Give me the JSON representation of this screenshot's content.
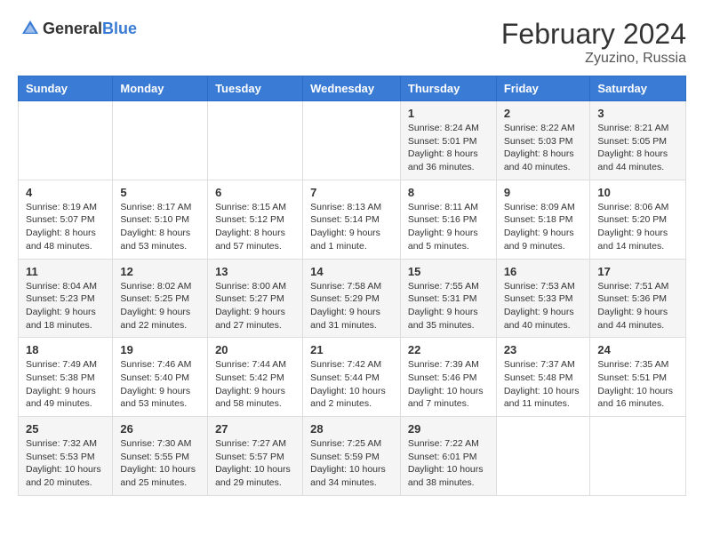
{
  "header": {
    "logo_general": "General",
    "logo_blue": "Blue",
    "month_year": "February 2024",
    "location": "Zyuzino, Russia"
  },
  "days_of_week": [
    "Sunday",
    "Monday",
    "Tuesday",
    "Wednesday",
    "Thursday",
    "Friday",
    "Saturday"
  ],
  "weeks": [
    [
      {
        "day": "",
        "info": ""
      },
      {
        "day": "",
        "info": ""
      },
      {
        "day": "",
        "info": ""
      },
      {
        "day": "",
        "info": ""
      },
      {
        "day": "1",
        "info": "Sunrise: 8:24 AM\nSunset: 5:01 PM\nDaylight: 8 hours and 36 minutes."
      },
      {
        "day": "2",
        "info": "Sunrise: 8:22 AM\nSunset: 5:03 PM\nDaylight: 8 hours and 40 minutes."
      },
      {
        "day": "3",
        "info": "Sunrise: 8:21 AM\nSunset: 5:05 PM\nDaylight: 8 hours and 44 minutes."
      }
    ],
    [
      {
        "day": "4",
        "info": "Sunrise: 8:19 AM\nSunset: 5:07 PM\nDaylight: 8 hours and 48 minutes."
      },
      {
        "day": "5",
        "info": "Sunrise: 8:17 AM\nSunset: 5:10 PM\nDaylight: 8 hours and 53 minutes."
      },
      {
        "day": "6",
        "info": "Sunrise: 8:15 AM\nSunset: 5:12 PM\nDaylight: 8 hours and 57 minutes."
      },
      {
        "day": "7",
        "info": "Sunrise: 8:13 AM\nSunset: 5:14 PM\nDaylight: 9 hours and 1 minute."
      },
      {
        "day": "8",
        "info": "Sunrise: 8:11 AM\nSunset: 5:16 PM\nDaylight: 9 hours and 5 minutes."
      },
      {
        "day": "9",
        "info": "Sunrise: 8:09 AM\nSunset: 5:18 PM\nDaylight: 9 hours and 9 minutes."
      },
      {
        "day": "10",
        "info": "Sunrise: 8:06 AM\nSunset: 5:20 PM\nDaylight: 9 hours and 14 minutes."
      }
    ],
    [
      {
        "day": "11",
        "info": "Sunrise: 8:04 AM\nSunset: 5:23 PM\nDaylight: 9 hours and 18 minutes."
      },
      {
        "day": "12",
        "info": "Sunrise: 8:02 AM\nSunset: 5:25 PM\nDaylight: 9 hours and 22 minutes."
      },
      {
        "day": "13",
        "info": "Sunrise: 8:00 AM\nSunset: 5:27 PM\nDaylight: 9 hours and 27 minutes."
      },
      {
        "day": "14",
        "info": "Sunrise: 7:58 AM\nSunset: 5:29 PM\nDaylight: 9 hours and 31 minutes."
      },
      {
        "day": "15",
        "info": "Sunrise: 7:55 AM\nSunset: 5:31 PM\nDaylight: 9 hours and 35 minutes."
      },
      {
        "day": "16",
        "info": "Sunrise: 7:53 AM\nSunset: 5:33 PM\nDaylight: 9 hours and 40 minutes."
      },
      {
        "day": "17",
        "info": "Sunrise: 7:51 AM\nSunset: 5:36 PM\nDaylight: 9 hours and 44 minutes."
      }
    ],
    [
      {
        "day": "18",
        "info": "Sunrise: 7:49 AM\nSunset: 5:38 PM\nDaylight: 9 hours and 49 minutes."
      },
      {
        "day": "19",
        "info": "Sunrise: 7:46 AM\nSunset: 5:40 PM\nDaylight: 9 hours and 53 minutes."
      },
      {
        "day": "20",
        "info": "Sunrise: 7:44 AM\nSunset: 5:42 PM\nDaylight: 9 hours and 58 minutes."
      },
      {
        "day": "21",
        "info": "Sunrise: 7:42 AM\nSunset: 5:44 PM\nDaylight: 10 hours and 2 minutes."
      },
      {
        "day": "22",
        "info": "Sunrise: 7:39 AM\nSunset: 5:46 PM\nDaylight: 10 hours and 7 minutes."
      },
      {
        "day": "23",
        "info": "Sunrise: 7:37 AM\nSunset: 5:48 PM\nDaylight: 10 hours and 11 minutes."
      },
      {
        "day": "24",
        "info": "Sunrise: 7:35 AM\nSunset: 5:51 PM\nDaylight: 10 hours and 16 minutes."
      }
    ],
    [
      {
        "day": "25",
        "info": "Sunrise: 7:32 AM\nSunset: 5:53 PM\nDaylight: 10 hours and 20 minutes."
      },
      {
        "day": "26",
        "info": "Sunrise: 7:30 AM\nSunset: 5:55 PM\nDaylight: 10 hours and 25 minutes."
      },
      {
        "day": "27",
        "info": "Sunrise: 7:27 AM\nSunset: 5:57 PM\nDaylight: 10 hours and 29 minutes."
      },
      {
        "day": "28",
        "info": "Sunrise: 7:25 AM\nSunset: 5:59 PM\nDaylight: 10 hours and 34 minutes."
      },
      {
        "day": "29",
        "info": "Sunrise: 7:22 AM\nSunset: 6:01 PM\nDaylight: 10 hours and 38 minutes."
      },
      {
        "day": "",
        "info": ""
      },
      {
        "day": "",
        "info": ""
      }
    ]
  ]
}
